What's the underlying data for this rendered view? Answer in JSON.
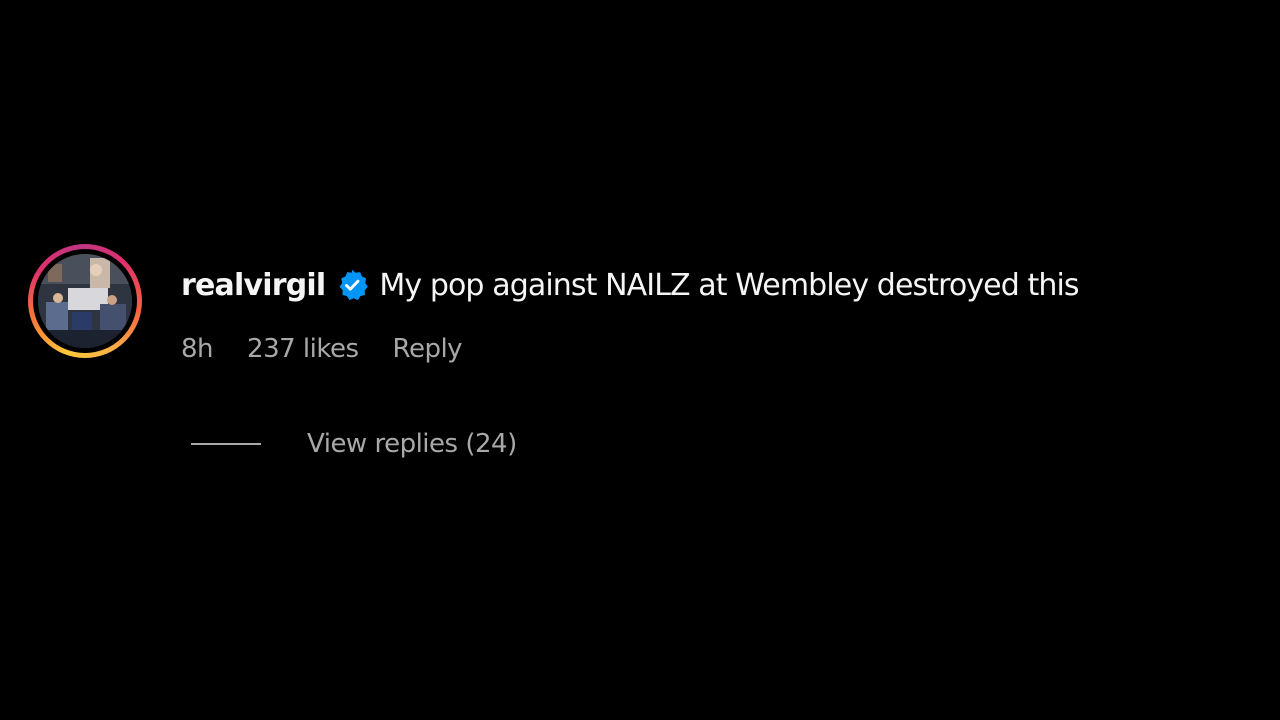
{
  "comment": {
    "username": "realvirgil",
    "verified_icon": "verified-badge-icon",
    "text": "My pop against NAILZ at Wembley destroyed this",
    "timestamp": "8h",
    "likes": "237 likes",
    "reply_label": "Reply",
    "view_replies_label": "View replies (24)"
  },
  "colors": {
    "background": "#000000",
    "primary_text": "#f5f5f5",
    "secondary_text": "#a8a8a8",
    "verified_blue": "#0095f6"
  }
}
